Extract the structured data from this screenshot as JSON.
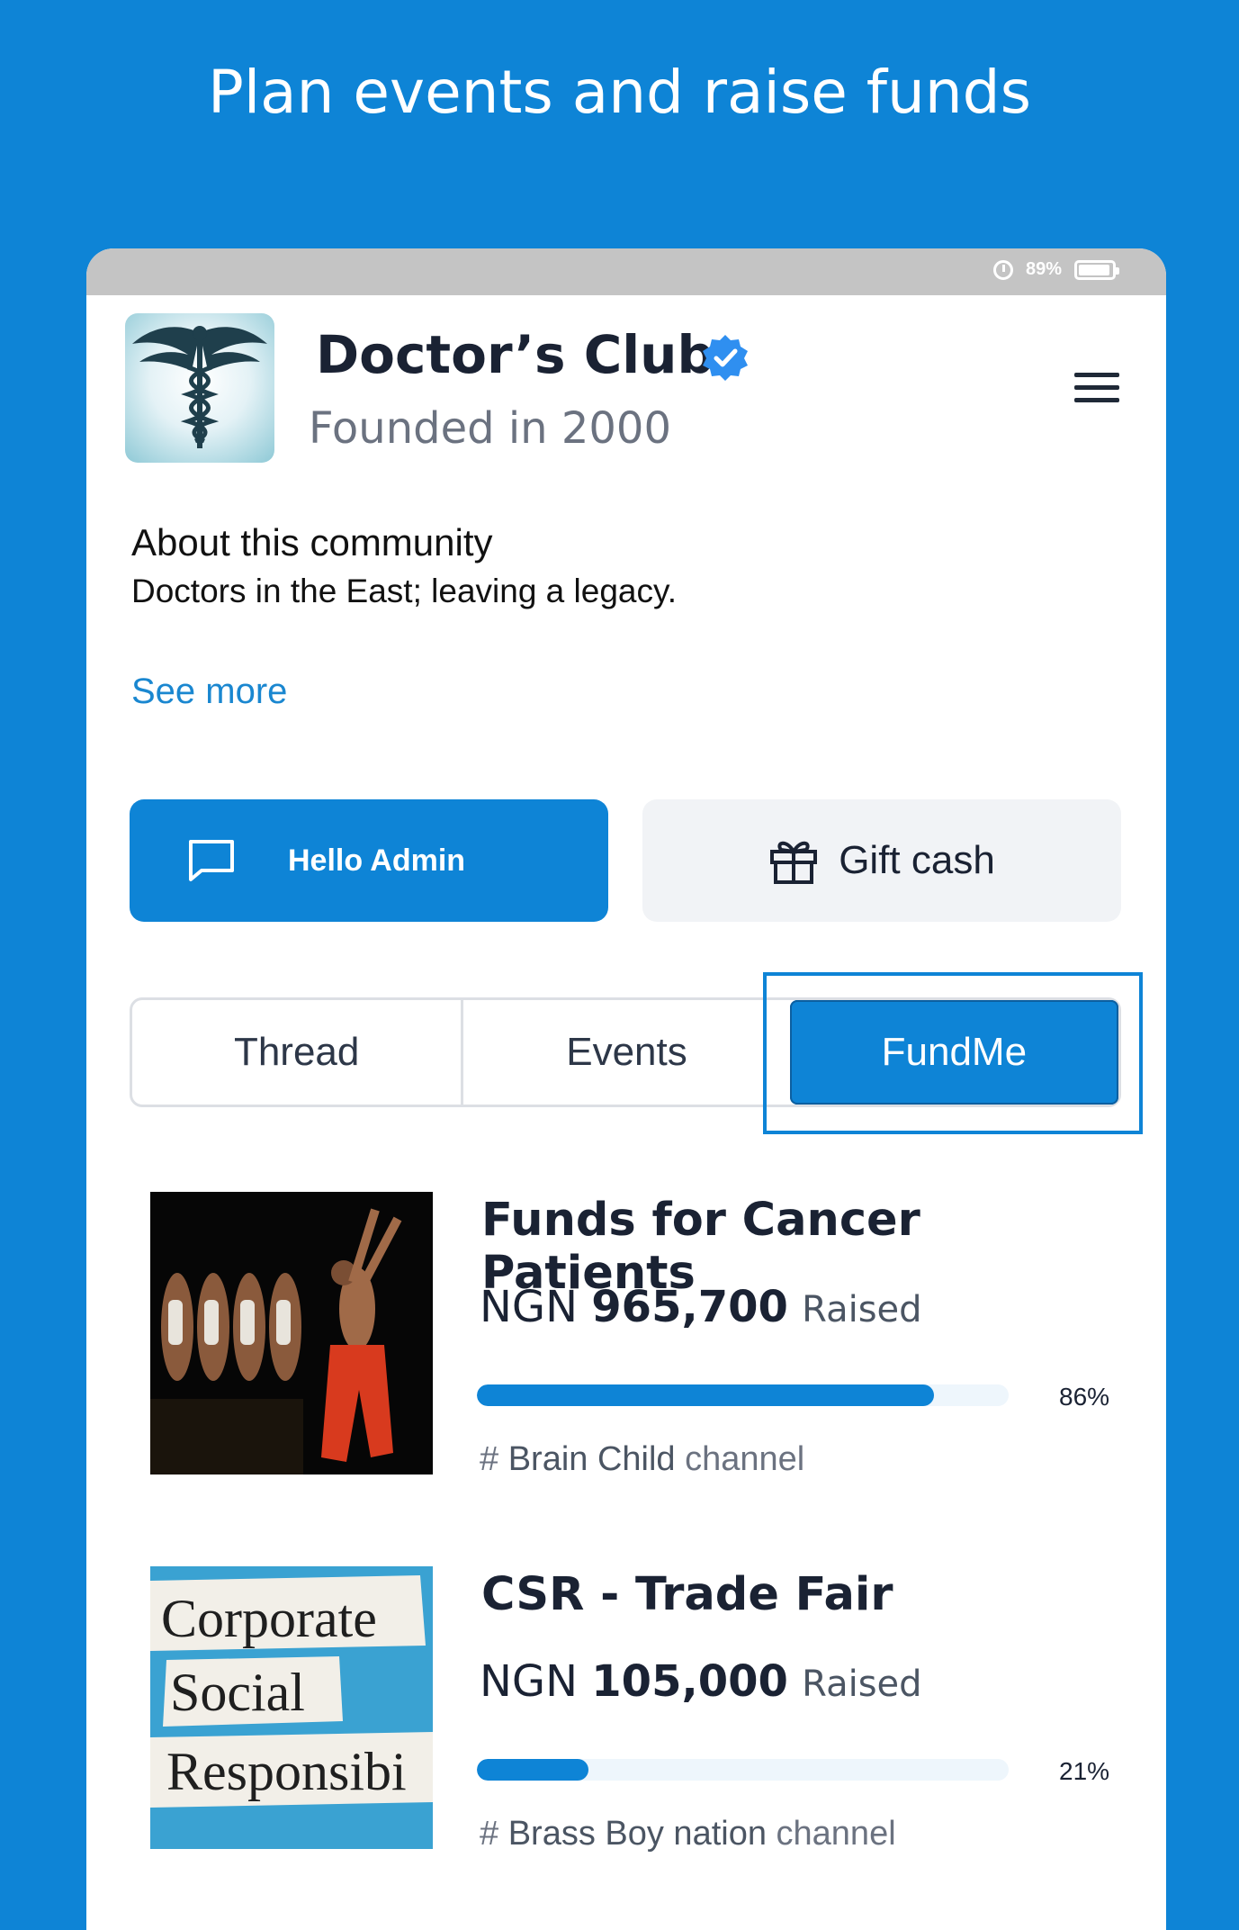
{
  "headline": "Plan events and raise funds",
  "status_bar": {
    "battery": "89%"
  },
  "club": {
    "name": "Doctor’s Club",
    "founded": "Founded in 2000"
  },
  "about": {
    "title": "About this community",
    "text": "Doctors in the East; leaving a legacy.",
    "see_more": "See more"
  },
  "actions": {
    "admin_label": "Hello Admin",
    "gift_label": "Gift cash"
  },
  "tabs": [
    {
      "label": "Thread"
    },
    {
      "label": "Events"
    },
    {
      "label": "FundMe",
      "active": true
    }
  ],
  "campaigns": [
    {
      "title": "Funds for Cancer Patients",
      "currency": "NGN",
      "amount": "965,700",
      "raised_word": "Raised",
      "progress": 0.86,
      "percent": "86%",
      "channel_hash": "#",
      "channel_name": "Brain Child",
      "channel_suffix": "channel"
    },
    {
      "title": "CSR - Trade Fair",
      "currency": "NGN",
      "amount": "105,000",
      "raised_word": "Raised",
      "progress": 0.21,
      "percent": "21%",
      "channel_hash": "#",
      "channel_name": "Brass Boy nation",
      "channel_suffix": "channel",
      "image_words": [
        "Corporate",
        "Social",
        "Responsibi"
      ]
    }
  ],
  "colors": {
    "accent": "#0e84d6",
    "background": "#0e84d6"
  }
}
